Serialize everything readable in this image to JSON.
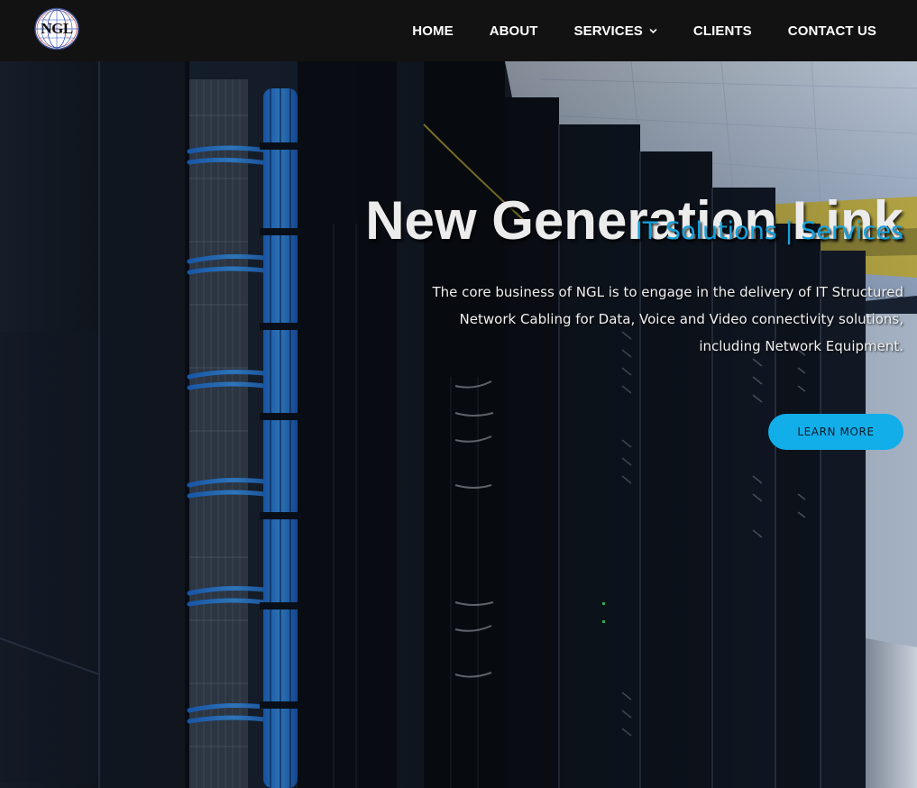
{
  "header": {
    "logo_text": "NGL",
    "nav": [
      {
        "label": "HOME"
      },
      {
        "label": "ABOUT"
      },
      {
        "label": "SERVICES",
        "has_dropdown": true
      },
      {
        "label": "CLIENTS"
      },
      {
        "label": "CONTACT US"
      }
    ]
  },
  "hero": {
    "title": "New Generation Link",
    "subtitle": "IT Solutions | Services",
    "description_lines": [
      "The core business of NGL is to engage in the delivery of IT Structured",
      "Network Cabling for Data, Voice and Video connectivity solutions,",
      "including Network Equipment."
    ],
    "cta_label": "LEARN MORE"
  },
  "colors": {
    "header_bg": "#121212",
    "accent": "#16a3de",
    "button_bg": "#12aeea",
    "title": "#ececec"
  },
  "icons": {
    "logo": "globe-logo-icon",
    "dropdown": "chevron-down-icon"
  }
}
